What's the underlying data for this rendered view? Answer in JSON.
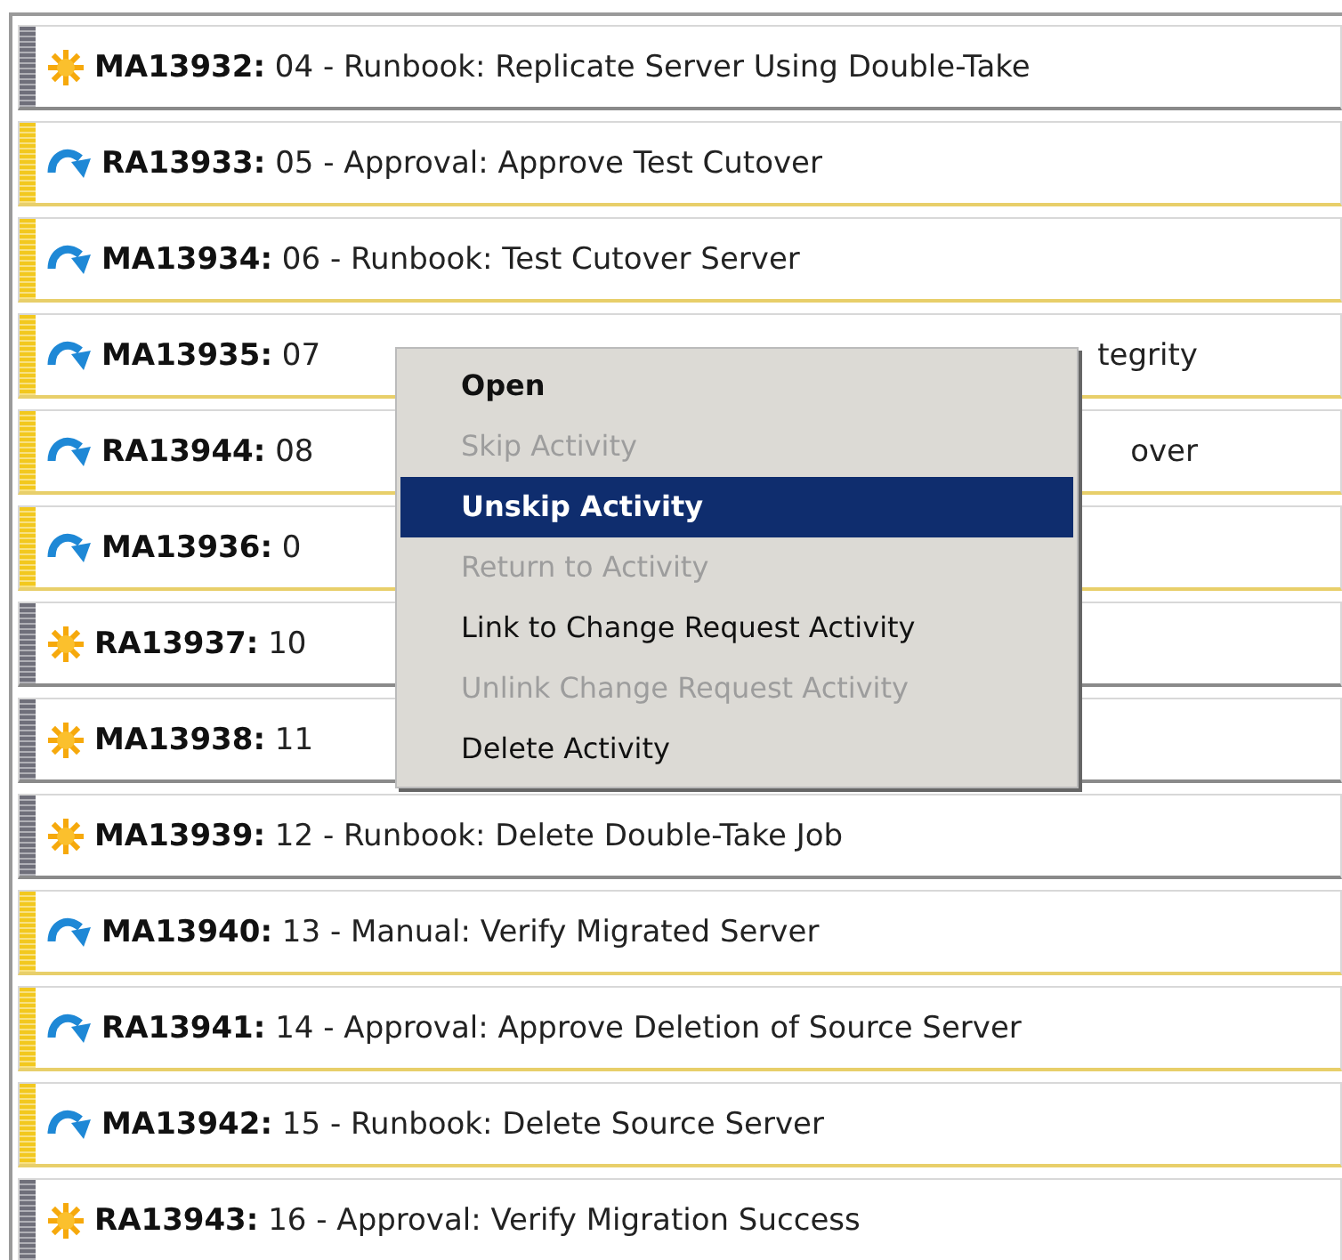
{
  "rows": [
    {
      "kind": "new",
      "id": "MA13932:",
      "description": "04 - Runbook: Replicate Server Using Double-Take"
    },
    {
      "kind": "in_progress",
      "id": "RA13933:",
      "description": "05 - Approval: Approve Test Cutover"
    },
    {
      "kind": "in_progress",
      "id": "MA13934:",
      "description": "06 - Runbook: Test Cutover Server"
    },
    {
      "kind": "in_progress",
      "id": "MA13935:",
      "description": "07",
      "tail": "tegrity"
    },
    {
      "kind": "in_progress",
      "id": "RA13944:",
      "description": "08",
      "tail": "over"
    },
    {
      "kind": "in_progress",
      "id": "MA13936:",
      "description": "0"
    },
    {
      "kind": "new",
      "id": "RA13937:",
      "description": "10"
    },
    {
      "kind": "new",
      "id": "MA13938:",
      "description": "11"
    },
    {
      "kind": "new",
      "id": "MA13939:",
      "description": "12 - Runbook: Delete Double-Take Job"
    },
    {
      "kind": "in_progress",
      "id": "MA13940:",
      "description": "13 - Manual: Verify Migrated Server"
    },
    {
      "kind": "in_progress",
      "id": "RA13941:",
      "description": "14 - Approval: Approve Deletion of Source Server"
    },
    {
      "kind": "in_progress",
      "id": "MA13942:",
      "description": "15 - Runbook: Delete Source Server"
    },
    {
      "kind": "new",
      "id": "RA13943:",
      "description": "16 - Approval: Verify Migration Success"
    }
  ],
  "context_menu": [
    {
      "label": "Open",
      "default": true,
      "disabled": false,
      "selected": false
    },
    {
      "label": "Skip Activity",
      "default": false,
      "disabled": true,
      "selected": false
    },
    {
      "label": "Unskip Activity",
      "default": false,
      "disabled": false,
      "selected": true
    },
    {
      "label": "Return to Activity",
      "default": false,
      "disabled": true,
      "selected": false
    },
    {
      "label": "Link to Change Request Activity",
      "default": false,
      "disabled": false,
      "selected": false
    },
    {
      "label": "Unlink Change Request Activity",
      "default": false,
      "disabled": true,
      "selected": false
    },
    {
      "label": "Delete Activity",
      "default": false,
      "disabled": false,
      "selected": false
    }
  ]
}
